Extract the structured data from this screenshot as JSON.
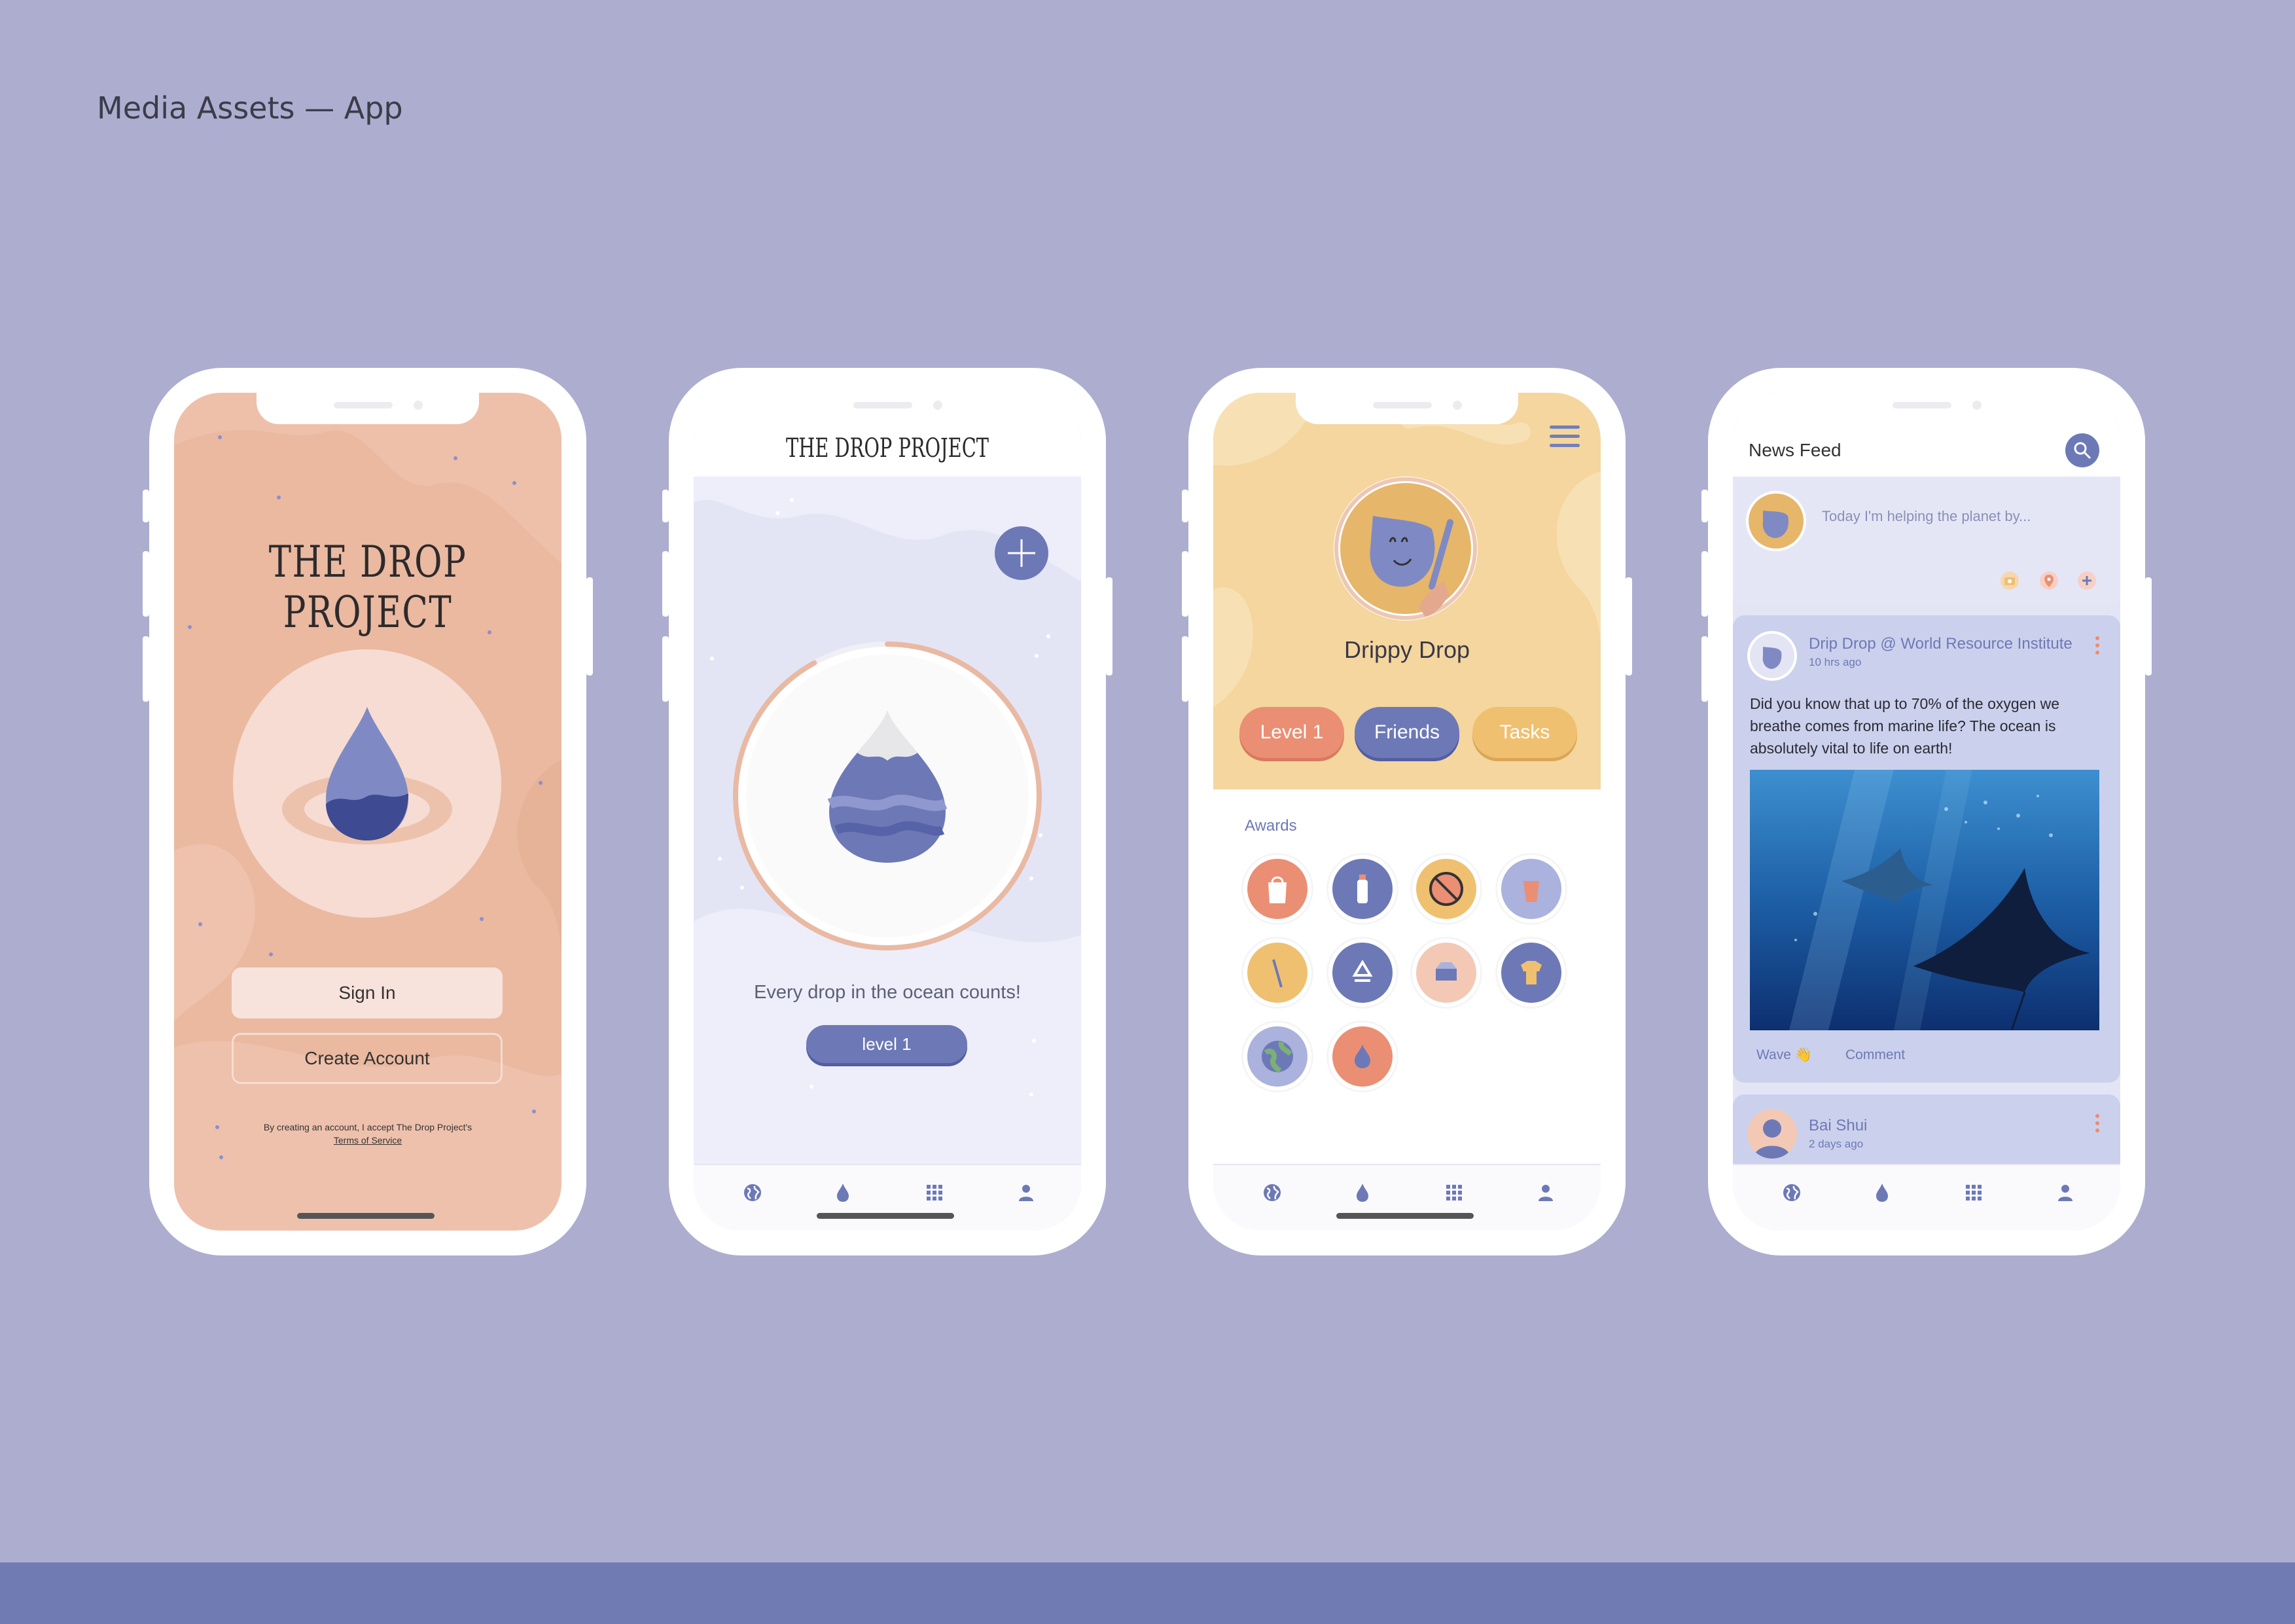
{
  "page": {
    "title": "Media Assets — App"
  },
  "colors": {
    "background": "#adadd0",
    "band": "#717bb3",
    "accent": "#6d79b6",
    "peach": "#eab9a0",
    "sand": "#f4d69e",
    "coral": "#ea8f74"
  },
  "screen1": {
    "brand": "THE DROP PROJECT",
    "sign_in": "Sign In",
    "create_account": "Create Account",
    "legal_line": "By creating an account, I accept The Drop Project's",
    "legal_link": "Terms of Service"
  },
  "screen2": {
    "brand": "THE DROP PROJECT",
    "add_icon": "plus-icon",
    "tagline": "Every drop in the ocean counts!",
    "level_button": "level 1"
  },
  "screen3": {
    "menu_icon": "hamburger-icon",
    "profile_name": "Drippy Drop",
    "pills": [
      "Level 1",
      "Friends",
      "Tasks"
    ],
    "awards_label": "Awards",
    "awards": [
      "plastic-bag-badge",
      "water-bottle-badge",
      "no-plastic-badge",
      "cup-badge",
      "straw-badge",
      "recycle-badge",
      "food-container-badge",
      "shirt-badge",
      "earth-badge",
      "water-drop-badge"
    ]
  },
  "screen4": {
    "title": "News Feed",
    "search_icon": "search-icon",
    "compose_prompt": "Today I'm helping the planet by...",
    "compose_icons": [
      "camera-icon",
      "location-pin-icon",
      "plus-icon"
    ],
    "post": {
      "author": "Drip Drop @ World Resource Institute",
      "time": "10 hrs ago",
      "text": "Did you know that up to 70% of the oxygen we breathe comes from marine life? The ocean is absolutely vital to life on earth!",
      "image": "manta-ray-ocean-photo",
      "wave": "Wave 👋",
      "comment": "Comment"
    },
    "next_post": {
      "author": "Bai Shui",
      "time": "2 days ago"
    }
  },
  "tabbar": [
    "globe-icon",
    "drop-icon",
    "grid-icon",
    "profile-icon"
  ]
}
